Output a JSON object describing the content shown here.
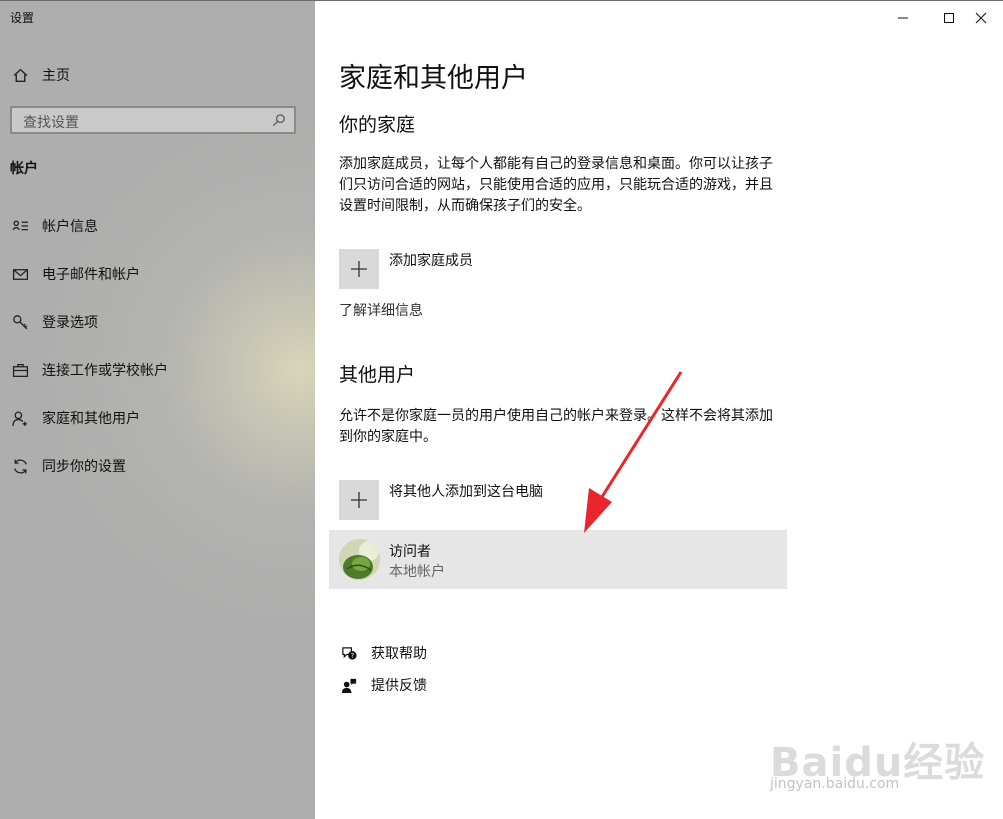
{
  "window": {
    "title": "设置"
  },
  "sidebar": {
    "home_label": "主页",
    "search_placeholder": "查找设置",
    "section_label": "帐户",
    "items": [
      {
        "label": "帐户信息",
        "icon": "account-info-icon"
      },
      {
        "label": "电子邮件和帐户",
        "icon": "mail-icon"
      },
      {
        "label": "登录选项",
        "icon": "key-icon"
      },
      {
        "label": "连接工作或学校帐户",
        "icon": "briefcase-icon"
      },
      {
        "label": "家庭和其他用户",
        "icon": "person-add-icon"
      },
      {
        "label": "同步你的设置",
        "icon": "sync-icon"
      }
    ]
  },
  "main": {
    "title": "家庭和其他用户",
    "family": {
      "heading": "你的家庭",
      "description": "添加家庭成员，让每个人都能有自己的登录信息和桌面。你可以让孩子们只访问合适的网站，只能使用合适的应用，只能玩合适的游戏，并且设置时间限制，从而确保孩子们的安全。",
      "add_label": "添加家庭成员",
      "learn_more": "了解详细信息"
    },
    "others": {
      "heading": "其他用户",
      "description": "允许不是你家庭一员的用户使用自己的帐户来登录。这样不会将其添加到你的家庭中。",
      "add_label": "将其他人添加到这台电脑",
      "user": {
        "name": "访问者",
        "type": "本地帐户"
      }
    },
    "help": [
      {
        "label": "获取帮助",
        "icon": "help-chat-icon"
      },
      {
        "label": "提供反馈",
        "icon": "feedback-icon"
      }
    ]
  },
  "watermark": {
    "main": "Baidu经验",
    "sub": "jingyan.baidu.com"
  },
  "colors": {
    "sidebar_bg": "#aeaeae",
    "card_bg": "#e6e6e6",
    "button_bg": "#d9d9d9",
    "arrow": "#e8262b"
  }
}
